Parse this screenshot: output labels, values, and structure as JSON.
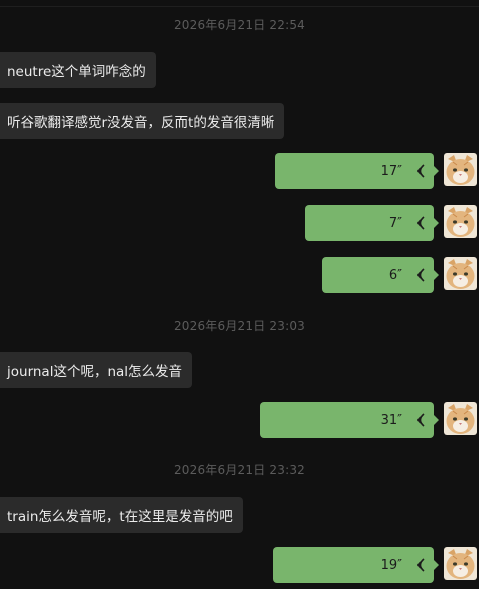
{
  "timestamps": [
    "2026年6月21日 22:54",
    "2026年6月21日 23:03",
    "2026年6月21日 23:32"
  ],
  "incoming": [
    "neutre这个单词咋念的",
    "听谷歌翻译感觉r没发音，反而t的发音很清晰",
    "journal这个呢，nal怎么发音",
    "train怎么发音呢，t在这里是发音的吧"
  ],
  "voice_messages": [
    {
      "duration": "17″",
      "seconds": 17
    },
    {
      "duration": "7″",
      "seconds": 7
    },
    {
      "duration": "6″",
      "seconds": 6
    },
    {
      "duration": "31″",
      "seconds": 31
    },
    {
      "duration": "19″",
      "seconds": 19
    }
  ],
  "colors": {
    "background": "#111111",
    "incoming_bubble": "#2b2b2b",
    "voice_bubble": "#79b56c",
    "timestamp_text": "#5c5c5c"
  },
  "icons": {
    "voice": "voice-wave-icon",
    "avatar": "cat-avatar"
  }
}
